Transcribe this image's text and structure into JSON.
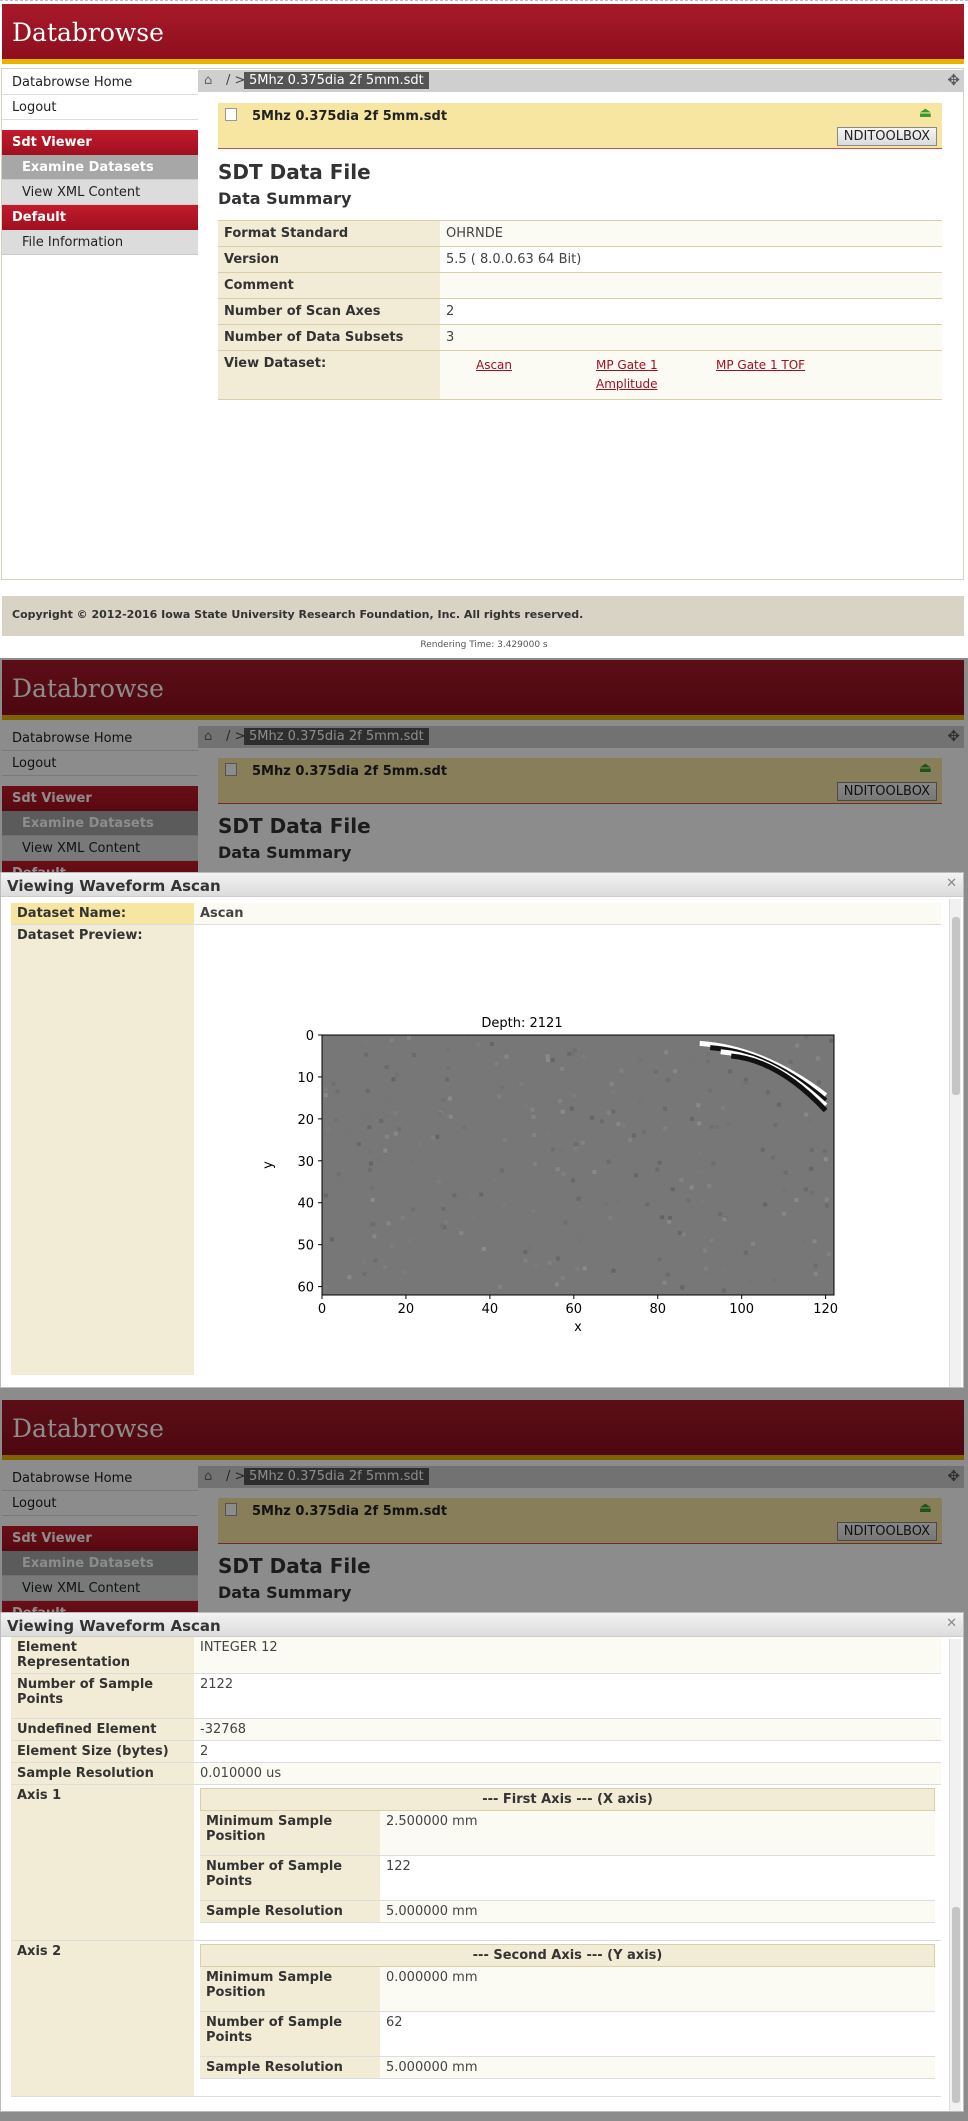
{
  "app": {
    "title": "Databrowse",
    "breadcrumb_sep": "/ >",
    "file_name": "5Mhz 0.375dia 2f 5mm.sdt",
    "home_icon": "home-icon",
    "move_icon": "move-icon"
  },
  "sidebar": {
    "home": "Databrowse Home",
    "logout": "Logout",
    "sdt_viewer": "Sdt Viewer",
    "examine": "Examine Datasets",
    "xml": "View XML Content",
    "default": "Default",
    "file_info": "File Information"
  },
  "file_band": {
    "toolbox": "NDITOOLBOX",
    "download_icon": "download-icon"
  },
  "page": {
    "heading": "SDT Data File",
    "subheading": "Data Summary"
  },
  "summary": {
    "format_label": "Format Standard",
    "format_value": "OHRNDE",
    "version_label": "Version",
    "version_value": "5.5 ( 8.0.0.63 64 Bit)",
    "comment_label": "Comment",
    "comment_value": "",
    "axes_label": "Number of Scan Axes",
    "axes_value": "2",
    "subsets_label": "Number of Data Subsets",
    "subsets_value": "3",
    "view_label": "View Dataset:",
    "links": [
      "Ascan",
      "MP Gate 1 Amplitude",
      "MP Gate 1 TOF"
    ]
  },
  "footer": {
    "copyright": "Copyright © 2012-2016 Iowa State University Research Foundation, Inc. All rights reserved.",
    "rendering_time": "Rendering Time: 3.429000 s"
  },
  "dialog": {
    "title": "Viewing Waveform Ascan",
    "close_icon": "close-icon",
    "dataset_name_label": "Dataset Name:",
    "dataset_name_value": "Ascan",
    "preview_label": "Dataset Preview:"
  },
  "chart_data": {
    "type": "heatmap",
    "title": "Depth: 2121",
    "xlabel": "x",
    "ylabel": "y",
    "xlim": [
      0,
      122
    ],
    "ylim": [
      62,
      0
    ],
    "xticks": [
      0,
      20,
      40,
      60,
      80,
      100,
      120
    ],
    "yticks": [
      0,
      10,
      20,
      30,
      40,
      50,
      60
    ],
    "colormap": "gray",
    "features": [
      {
        "x_range": [
          90,
          120
        ],
        "y_range": [
          2,
          18
        ],
        "description": "diagonal bright/dark bands"
      }
    ],
    "background_color": "#777777"
  },
  "details": {
    "elem_repr_label": "Element Representation",
    "elem_repr_value": "INTEGER 12",
    "num_points_label": "Number of Sample Points",
    "num_points_value": "2122",
    "undef_label": "Undefined Element",
    "undef_value": "-32768",
    "elem_size_label": "Element Size (bytes)",
    "elem_size_value": "2",
    "res_label": "Sample Resolution",
    "res_value": "0.010000 us",
    "axis1_label": "Axis 1",
    "axis1_header": "--- First Axis --- (X axis)",
    "axis1_min_label": "Minimum Sample Position",
    "axis1_min_value": "2.500000 mm",
    "axis1_num_label": "Number of Sample Points",
    "axis1_num_value": "122",
    "axis1_res_label": "Sample Resolution",
    "axis1_res_value": "5.000000 mm",
    "axis2_label": "Axis 2",
    "axis2_header": "--- Second Axis --- (Y axis)",
    "axis2_min_label": "Minimum Sample Position",
    "axis2_min_value": "0.000000 mm",
    "axis2_num_label": "Number of Sample Points",
    "axis2_num_value": "62",
    "axis2_res_label": "Sample Resolution",
    "axis2_res_value": "5.000000 mm"
  }
}
